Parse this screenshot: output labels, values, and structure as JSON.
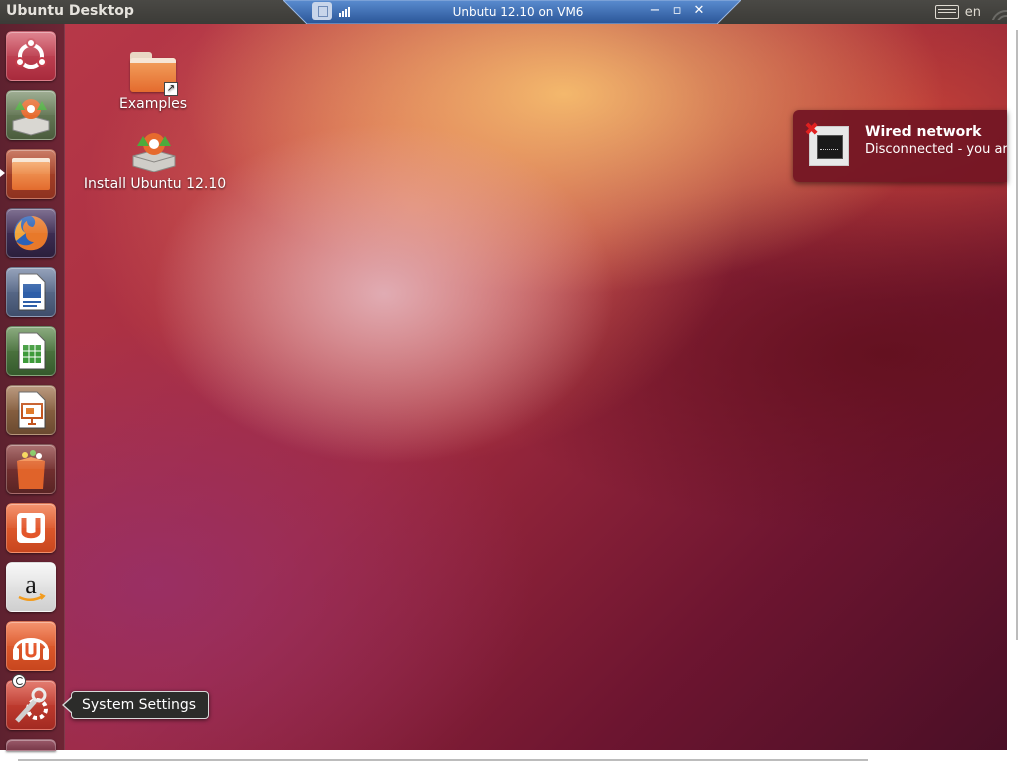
{
  "top_panel": {
    "title": "Ubuntu Desktop",
    "keyboard_layout": "en"
  },
  "vm_bar": {
    "title": "Unbutu 12.10 on VM6",
    "minimize_glyph": "−",
    "restore_glyph": "▫",
    "close_glyph": "✕"
  },
  "desktop_icons": [
    {
      "label": "Examples",
      "icon": "folder-icon"
    },
    {
      "label": "Install Ubuntu 12.10",
      "icon": "installer-icon"
    }
  ],
  "launcher": {
    "items": [
      {
        "name": "dash-home",
        "icon": "ubuntu-logo-icon",
        "color": "#c43c4b"
      },
      {
        "name": "install-ubuntu",
        "icon": "installer-icon",
        "color": "#d9d7d2"
      },
      {
        "name": "files",
        "icon": "folder-icon",
        "color": "#e8773a",
        "active": true
      },
      {
        "name": "firefox",
        "icon": "firefox-icon",
        "color": "#c2471e"
      },
      {
        "name": "libreoffice-writer",
        "icon": "writer-icon",
        "color": "#dfe3ea"
      },
      {
        "name": "libreoffice-calc",
        "icon": "calc-icon",
        "color": "#e3ebde"
      },
      {
        "name": "libreoffice-impress",
        "icon": "impress-icon",
        "color": "#ece3da"
      },
      {
        "name": "ubuntu-software-center",
        "icon": "shopping-bag-icon",
        "color": "#bc4a25"
      },
      {
        "name": "ubuntu-one",
        "icon": "ubuntu-one-icon",
        "color": "#e3562a"
      },
      {
        "name": "amazon",
        "icon": "amazon-icon",
        "color": "#e9e9e9"
      },
      {
        "name": "ubuntu-one-music",
        "icon": "ubuntu-one-music-icon",
        "color": "#e3562a"
      },
      {
        "name": "system-settings",
        "icon": "settings-icon",
        "color": "#c63a32"
      }
    ],
    "tooltip": "System Settings"
  },
  "notification": {
    "title": "Wired network",
    "body": "Disconnected - you are n",
    "icon": "network-disconnected-icon"
  },
  "colors": {
    "panel": "#3c3b37",
    "vm_bar": "#2f5e9e",
    "launcher": "#5e1c2c",
    "notification": "#74162a"
  }
}
